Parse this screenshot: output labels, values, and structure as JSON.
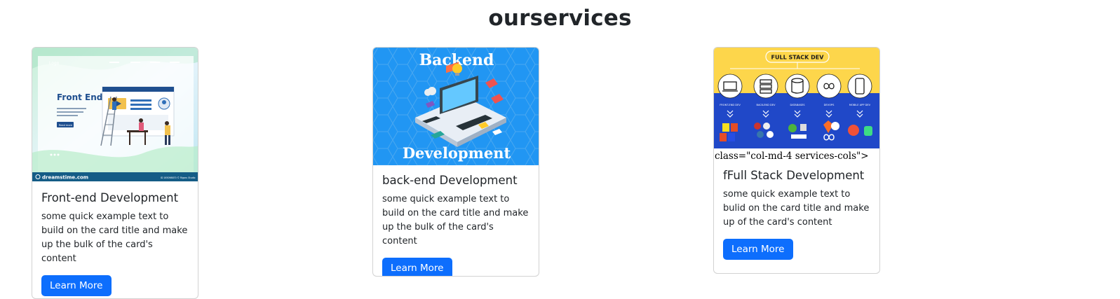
{
  "page": {
    "title": "ourservices"
  },
  "cards": [
    {
      "title": "Front-end Development",
      "text": "some quick example text to build on the card title and make up the bulk of the card's content",
      "button": "Learn More",
      "image": {
        "heading": "Front End",
        "footer_brand": "dreamstime.com",
        "footer_id": "ID 165098870 © Rigaru Studio",
        "nav_logo": "Logo",
        "button_label": "Read more"
      }
    },
    {
      "title": "back-end Development",
      "text": "some quick example text to build on the card title and make up the bulk of the card's content",
      "button": "Learn More",
      "image": {
        "top_text": "Backend",
        "bottom_text": "Development"
      }
    },
    {
      "title": "fFull Stack Development",
      "text": "some quick example text to bulid on the card title and make up of the card's content",
      "button": "Learn More",
      "stray_text": "class=\"col-md-4 services-cols\">",
      "image": {
        "header": "FULL STACK DEV",
        "columns": [
          "FRONT-END DEV",
          "BACK-END DEV",
          "DATABASES",
          "DEVOPS",
          "MOBILE APP DEV"
        ]
      }
    }
  ]
}
